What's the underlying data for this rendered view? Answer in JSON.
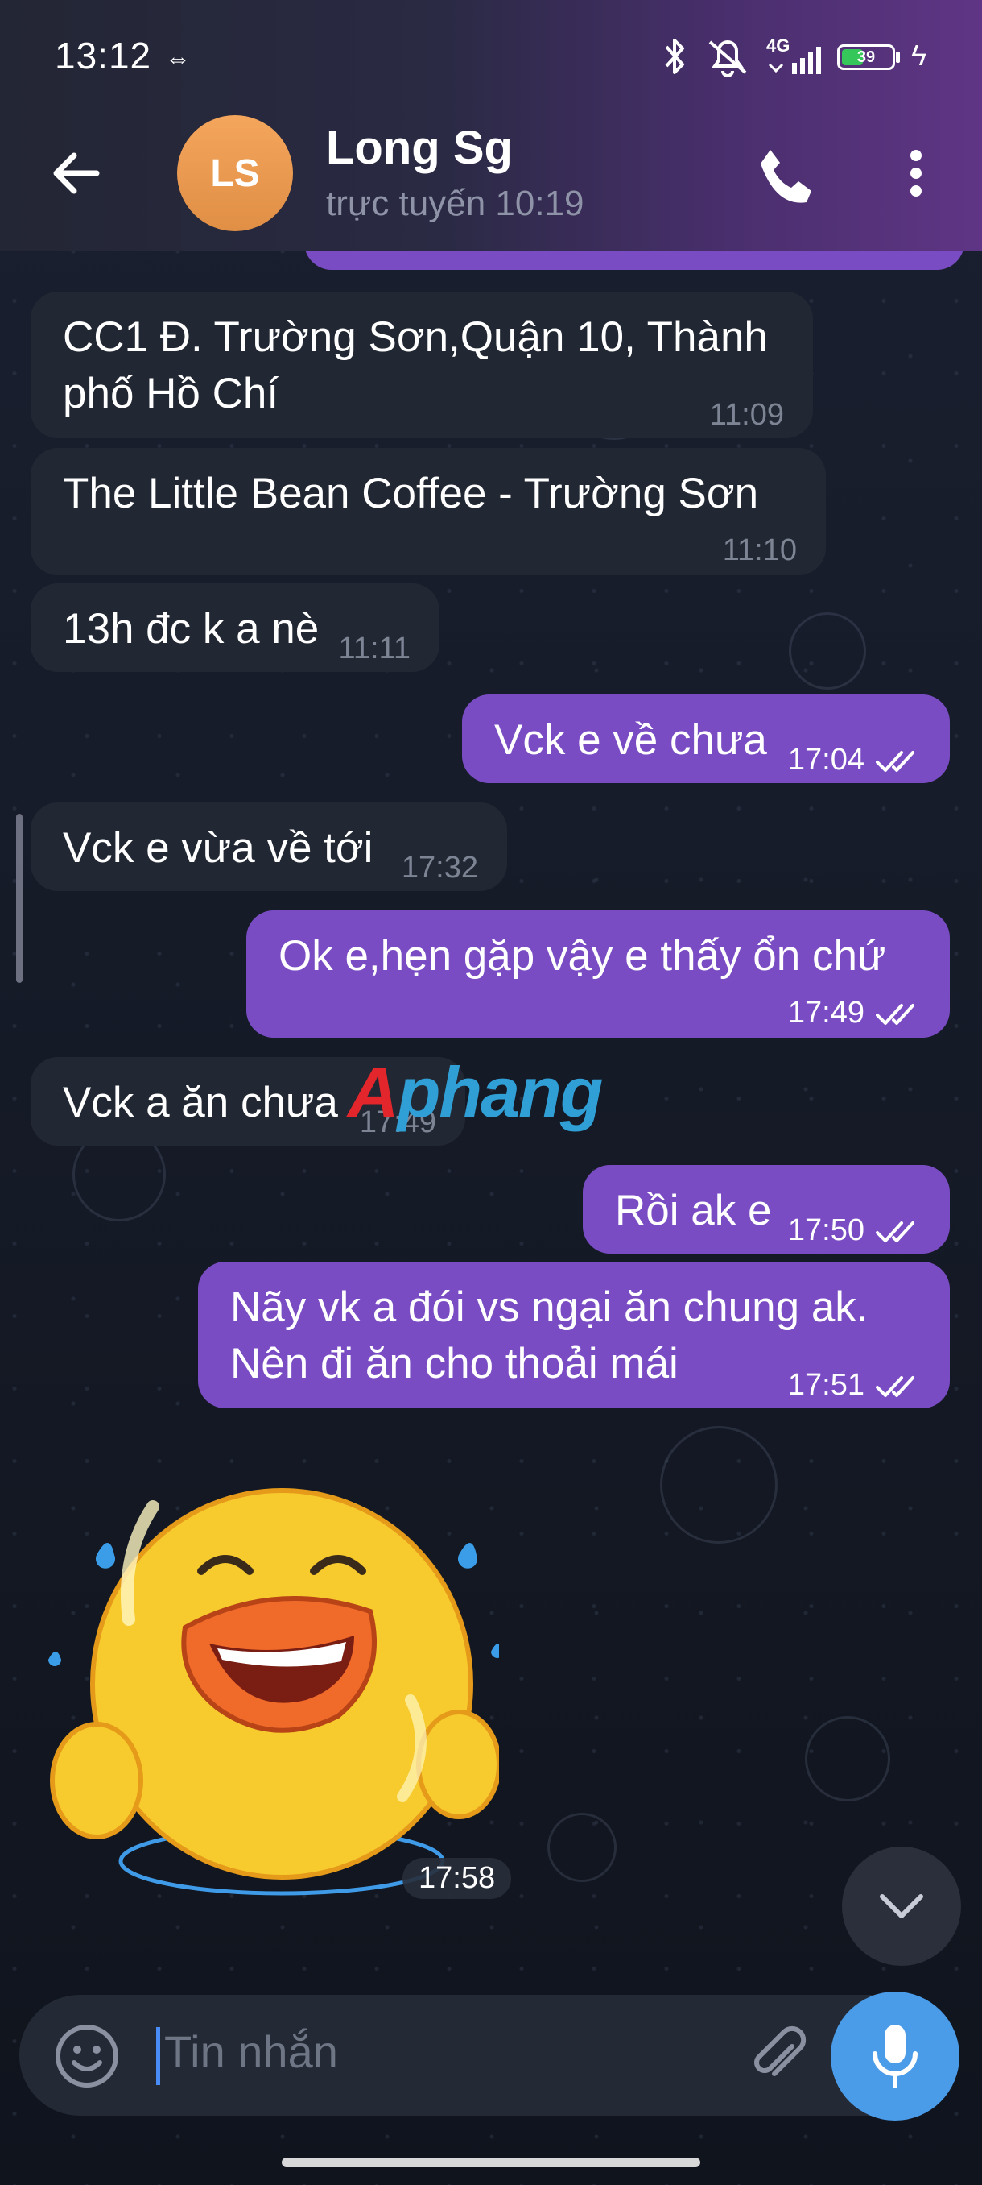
{
  "status_bar": {
    "time": "13:12",
    "network": "4G",
    "battery": "39",
    "battery_fraction": 0.39
  },
  "header": {
    "avatar_initials": "LS",
    "name": "Long Sg",
    "status": "trực tuyến 10:19"
  },
  "messages": [
    {
      "dir": "in",
      "lines": [
        "CC1 Đ. Trường Sơn,Quận 10, Thành",
        "phố Hồ Chí"
      ],
      "time": "11:09"
    },
    {
      "dir": "in",
      "lines": [
        "The Little Bean Coffee - Trường Sơn"
      ],
      "time": "11:10"
    },
    {
      "dir": "in",
      "lines": [
        "13h đc k a nè"
      ],
      "time": "11:11"
    },
    {
      "dir": "out",
      "lines": [
        "Vck e về chưa"
      ],
      "time": "17:04"
    },
    {
      "dir": "in",
      "lines": [
        "Vck e vừa về tới"
      ],
      "time": "17:32"
    },
    {
      "dir": "out",
      "lines": [
        "Ok e,hẹn gặp vậy e thấy ổn chứ"
      ],
      "time": "17:49"
    },
    {
      "dir": "in",
      "lines": [
        "Vck a ăn chưa"
      ],
      "time": "17:49"
    },
    {
      "dir": "out",
      "lines": [
        "Rồi ak e"
      ],
      "time": "17:50"
    },
    {
      "dir": "out",
      "lines": [
        "Nãy vk a đói vs ngại ăn chung ak.",
        "Nên đi ăn cho thoải mái"
      ],
      "time": "17:51"
    }
  ],
  "sticker": {
    "time": "17:58"
  },
  "watermark": {
    "first": "A",
    "rest": "phang"
  },
  "input": {
    "placeholder": "Tin nhắn"
  },
  "colors": {
    "incoming_bubble": "#222833",
    "outgoing_bubble": "#7a4cc4",
    "accent": "#4a9be8"
  }
}
